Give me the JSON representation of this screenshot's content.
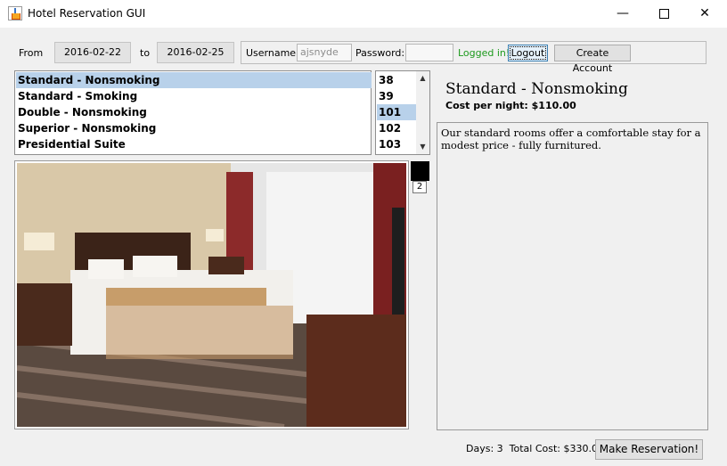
{
  "window": {
    "title": "Hotel Reservation GUI",
    "min": "—",
    "close": "✕"
  },
  "dates": {
    "from_label": "From",
    "from_value": "2016-02-22",
    "to_label": "to",
    "to_value": "2016-02-25"
  },
  "login": {
    "username_label": "Username:",
    "username_value": "ajsnyde",
    "password_label": "Password:",
    "password_value": "",
    "status": "Logged in!",
    "status_color": "#1c9a1c",
    "logout_label": "Logout",
    "create_label": "Create Account"
  },
  "room_types": [
    {
      "label": "Standard - Nonsmoking",
      "selected": true
    },
    {
      "label": "Standard - Smoking",
      "selected": false
    },
    {
      "label": "Double - Nonsmoking",
      "selected": false
    },
    {
      "label": "Superior - Nonsmoking",
      "selected": false
    },
    {
      "label": "Presidential Suite",
      "selected": false
    }
  ],
  "room_numbers": [
    {
      "label": "38",
      "selected": false
    },
    {
      "label": "39",
      "selected": false
    },
    {
      "label": "101",
      "selected": true
    },
    {
      "label": "102",
      "selected": false
    },
    {
      "label": "103",
      "selected": false
    }
  ],
  "detail": {
    "title": "Standard - Nonsmoking",
    "cost": "Cost per night: $110.00",
    "description": "Our standard rooms offer a comfortable stay for a modest price - fully furnitured."
  },
  "photo": {
    "page": "2"
  },
  "footer": {
    "summary": "Days: 3  Total Cost: $330.00",
    "reserve_label": "Make Reservation!"
  }
}
